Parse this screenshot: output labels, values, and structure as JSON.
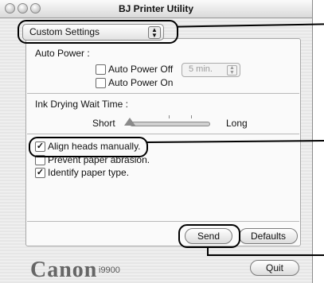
{
  "window": {
    "title": "BJ Printer Utility"
  },
  "popup": {
    "label": "Custom Settings"
  },
  "auto_power": {
    "heading": "Auto Power :",
    "off_label": "Auto Power Off",
    "off_checked": false,
    "off_time": "5 min.",
    "on_label": "Auto Power On",
    "on_checked": false
  },
  "ink_drying": {
    "heading": "Ink Drying Wait Time :",
    "short_label": "Short",
    "long_label": "Long",
    "level": 0.0
  },
  "options": [
    {
      "label": "Align heads manually.",
      "checked": true
    },
    {
      "label": "Prevent paper abrasion.",
      "checked": false
    },
    {
      "label": "Identify paper type.",
      "checked": true
    }
  ],
  "buttons": {
    "send": "Send",
    "defaults": "Defaults",
    "quit": "Quit"
  },
  "footer": {
    "brand": "Canon",
    "model": "i9900"
  }
}
